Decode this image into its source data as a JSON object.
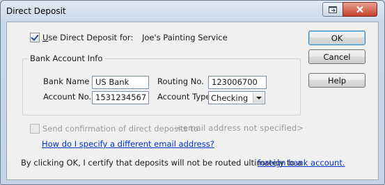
{
  "window": {
    "title": "Direct Deposit",
    "help_icon": "context-help-icon",
    "close_icon": "close-x-icon"
  },
  "use_direct_deposit": {
    "checked": true,
    "label_prefix": "U",
    "label_rest": "se Direct Deposit for:",
    "employee_name": "Joe's Painting Service"
  },
  "bank_account": {
    "group_label": "Bank Account Info",
    "bank_name_label": "Bank Name",
    "bank_name_value": "US Bank",
    "routing_label": "Routing No.",
    "routing_value": "123006700",
    "account_no_label": "Account No.",
    "account_no_value": "1531234567",
    "account_type_label": "Account Type",
    "account_type_value": "Checking"
  },
  "confirmation": {
    "checked": false,
    "label": "Send confirmation of direct deposits to",
    "email_placeholder": "<email address not specified>",
    "help_link": "How do I specify a different email address?"
  },
  "certify": {
    "text": "By clicking OK, I certify that deposits will not be routed ultimately to a",
    "link": "foreign bank account."
  },
  "buttons": {
    "ok": "OK",
    "cancel": "Cancel",
    "help": "Help"
  }
}
